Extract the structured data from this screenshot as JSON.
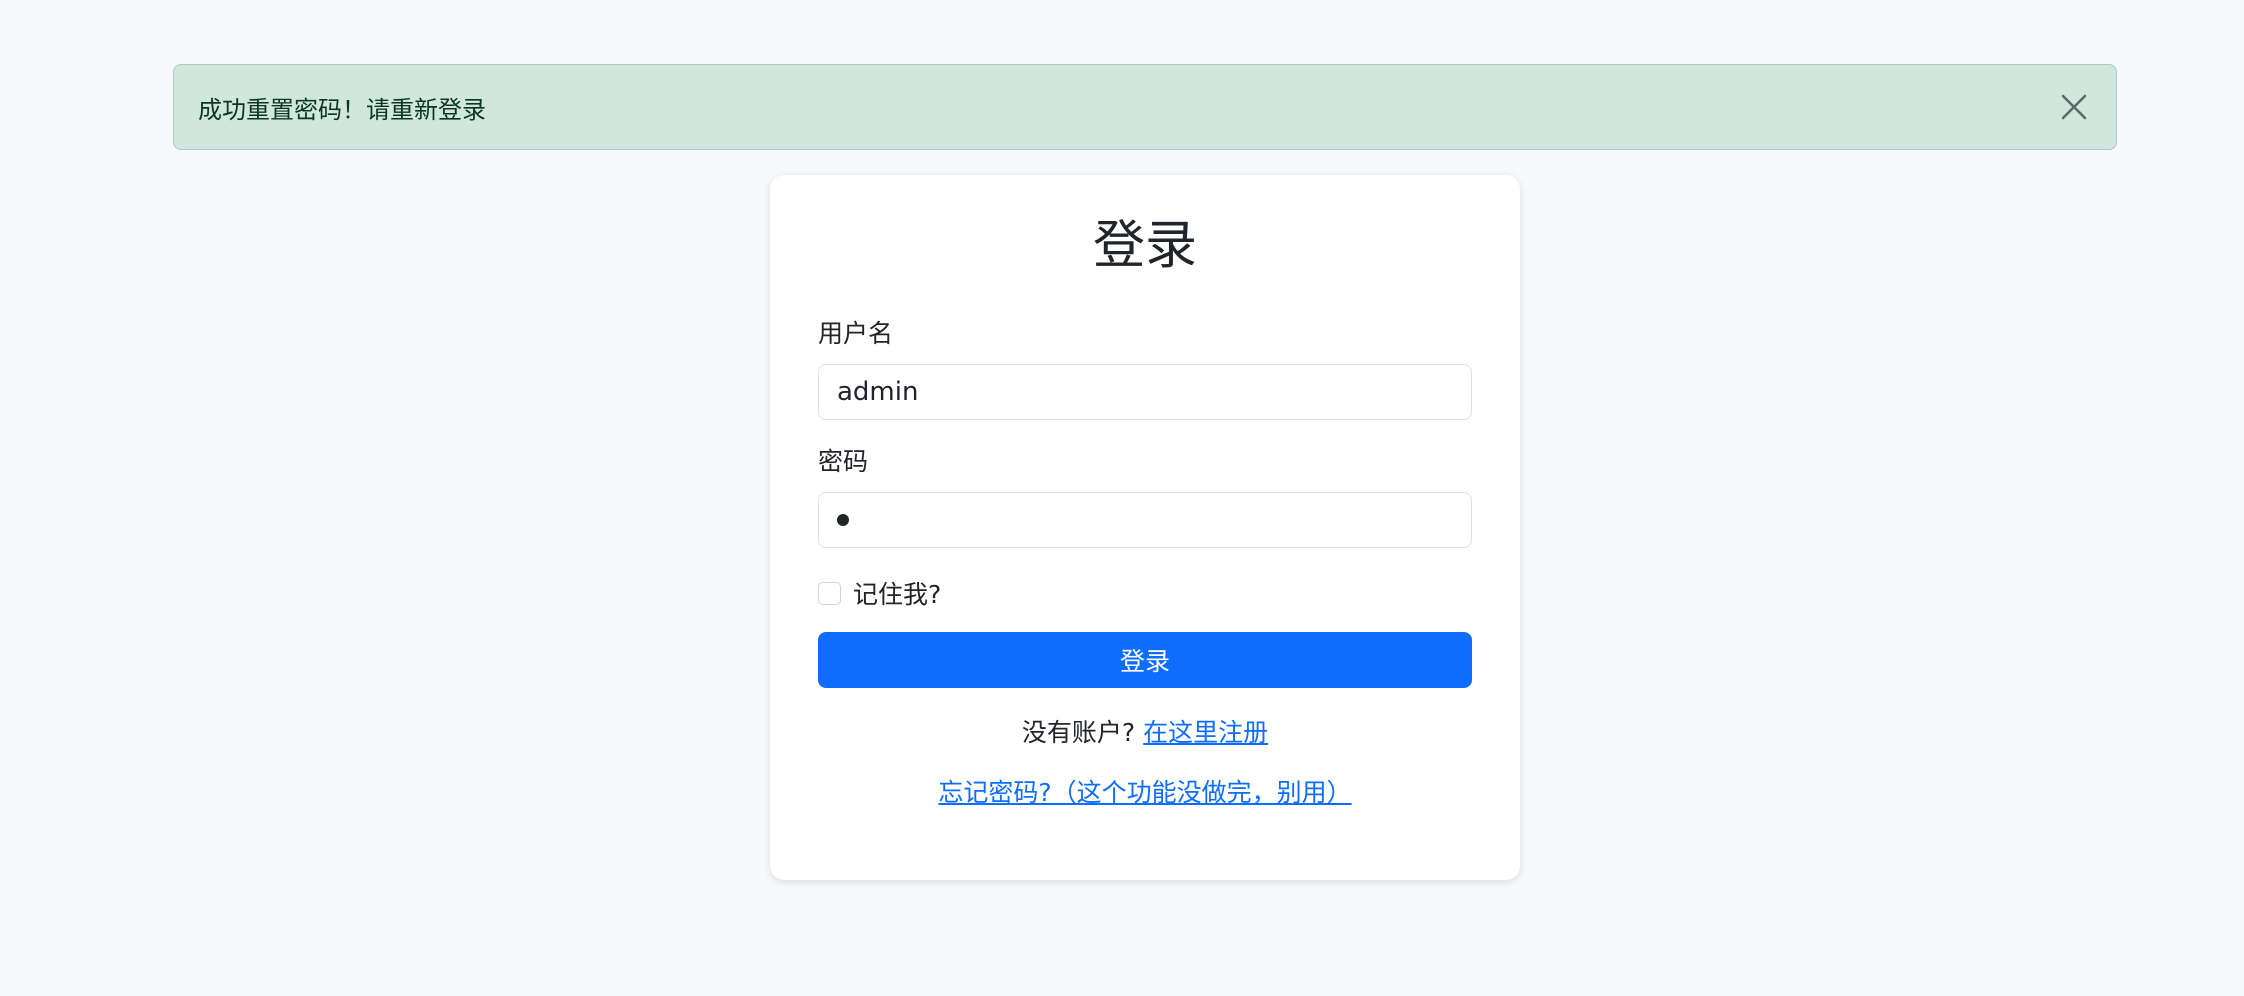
{
  "alert": {
    "message": "成功重置密码！请重新登录",
    "close_icon": "close-icon",
    "bg_color": "#d1e7dd",
    "text_color": "#0a3622"
  },
  "login": {
    "title": "登录",
    "username_label": "用户名",
    "username_value": "admin",
    "password_label": "密码",
    "password_masked_length": 1,
    "remember_label": "记住我?",
    "remember_checked": false,
    "submit_label": "登录",
    "no_account_text": "没有账户? ",
    "register_link": "在这里注册",
    "forgot_link": "忘记密码?（这个功能没做完，别用）",
    "accent_color": "#0d6efd"
  }
}
